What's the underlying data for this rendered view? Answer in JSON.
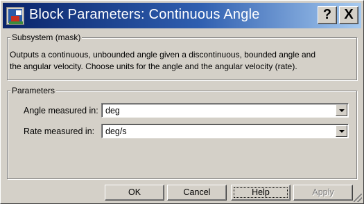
{
  "window": {
    "title": "Block Parameters: Continuous Angle",
    "icon": "simulink-block-icon",
    "caption_buttons": {
      "help": "?",
      "close": "X"
    }
  },
  "mask": {
    "group_label": "Subsystem (mask)",
    "description": [
      "Outputs a continuous, unbounded angle given a discontinuous, bounded angle and",
      "the angular velocity. Choose units for the angle and the angular velocity (rate)."
    ]
  },
  "parameters": {
    "group_label": "Parameters",
    "angle": {
      "label": "Angle measured in:",
      "value": "deg"
    },
    "rate": {
      "label": "Rate measured in:",
      "value": "deg/s"
    }
  },
  "buttons": {
    "ok": "OK",
    "cancel": "Cancel",
    "help": "Help",
    "apply": "Apply",
    "apply_enabled": false
  },
  "colors": {
    "titlebar_start": "#0a246a",
    "titlebar_end": "#a6caf0",
    "face": "#d4d0c8"
  }
}
